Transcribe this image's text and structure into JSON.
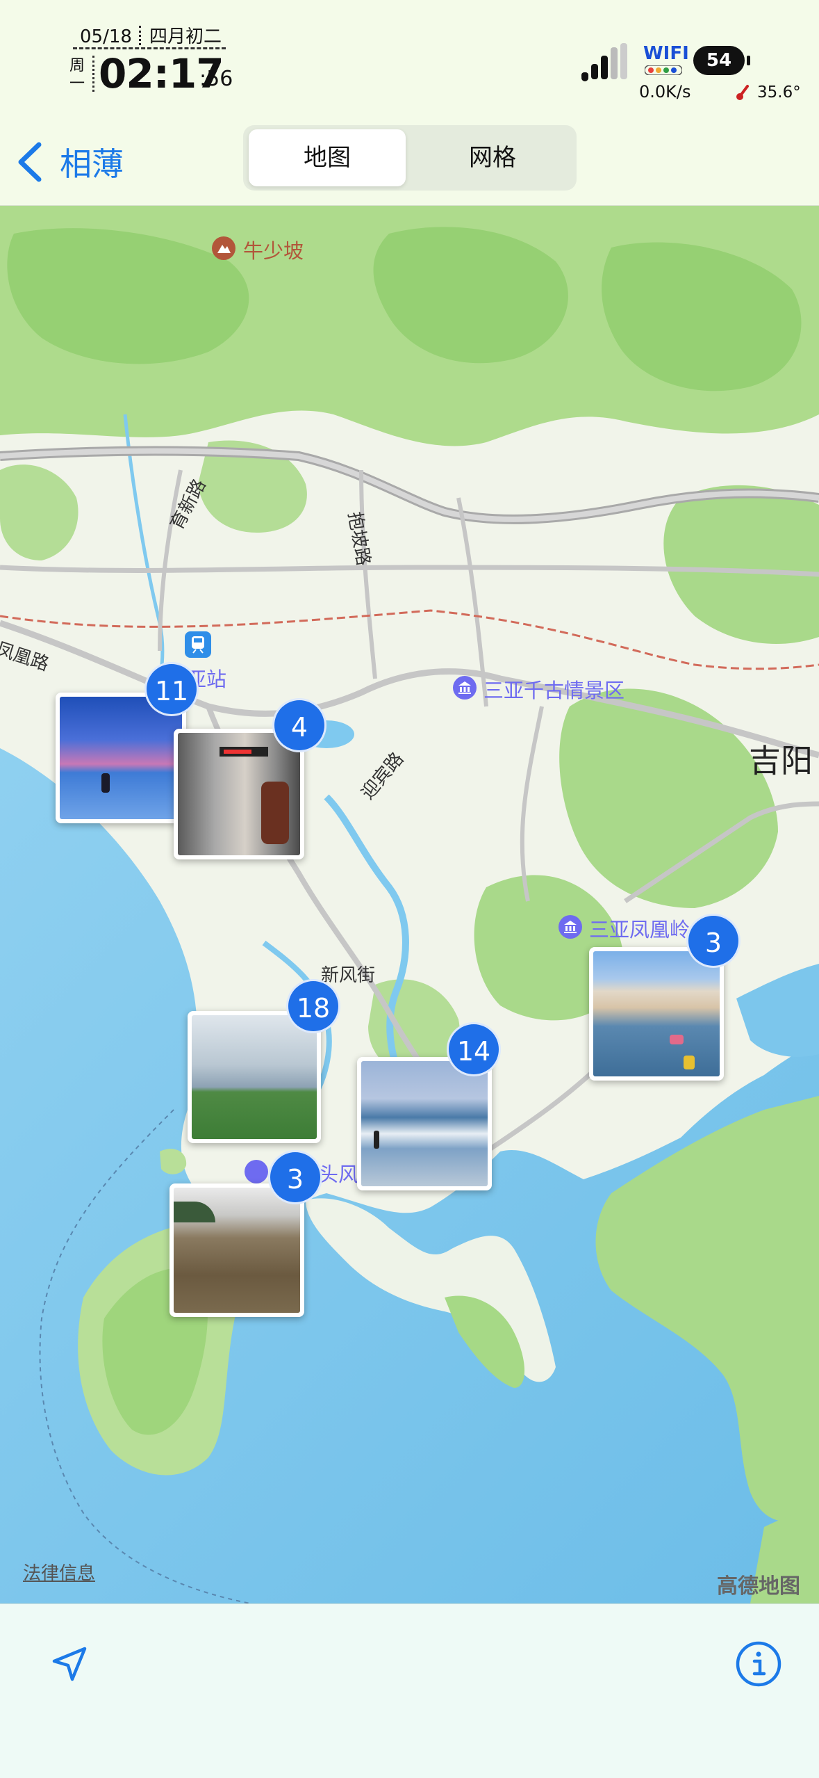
{
  "status_bar": {
    "date": "05/18",
    "lunar_date": "四月初二",
    "weekday": "周一",
    "time": "02:17",
    "seconds": ":56",
    "wifi_label": "WIFI",
    "net_speed": "0.0K/s",
    "battery": "54",
    "temperature": "35.6°"
  },
  "nav": {
    "back_label": "相薄",
    "segments": [
      "地图",
      "网格"
    ],
    "active_segment": "地图"
  },
  "map": {
    "pois": {
      "niushaopo": "牛少坡",
      "station": "亚站",
      "qiangu": "三亚千古情景区",
      "fenghuangling": "三亚凤凰岭",
      "toufeng": "头风"
    },
    "roads": {
      "yumian": "育新路",
      "baopo": "抱坡路",
      "yingbin": "迎宾路",
      "xinfeng": "新风街",
      "fenghuang": "凤凰路"
    },
    "district": "吉阳",
    "legal_link": "法律信息",
    "attribution": "高德地图",
    "clusters": [
      {
        "count": "11",
        "photo_icon": "sunset-beach-photo"
      },
      {
        "count": "4",
        "photo_icon": "bus-interior-photo"
      },
      {
        "count": "18",
        "photo_icon": "hill-sea-view-photo"
      },
      {
        "count": "14",
        "photo_icon": "surf-beach-photo"
      },
      {
        "count": "3",
        "photo_icon": "rocky-shore-photo"
      },
      {
        "count": "3",
        "photo_icon": "crowded-beach-photo"
      }
    ]
  },
  "toolbar": {
    "location_icon": "location-arrow-icon",
    "info_icon": "info-icon"
  },
  "colors": {
    "accent": "#1c7ae8",
    "badge": "#1f6fe8",
    "sea": "#7cc6ec",
    "land": "#f2f4ee",
    "green": "#a8d98a",
    "poi_purple": "#6e6bf0",
    "poi_brown": "#b2563a"
  }
}
